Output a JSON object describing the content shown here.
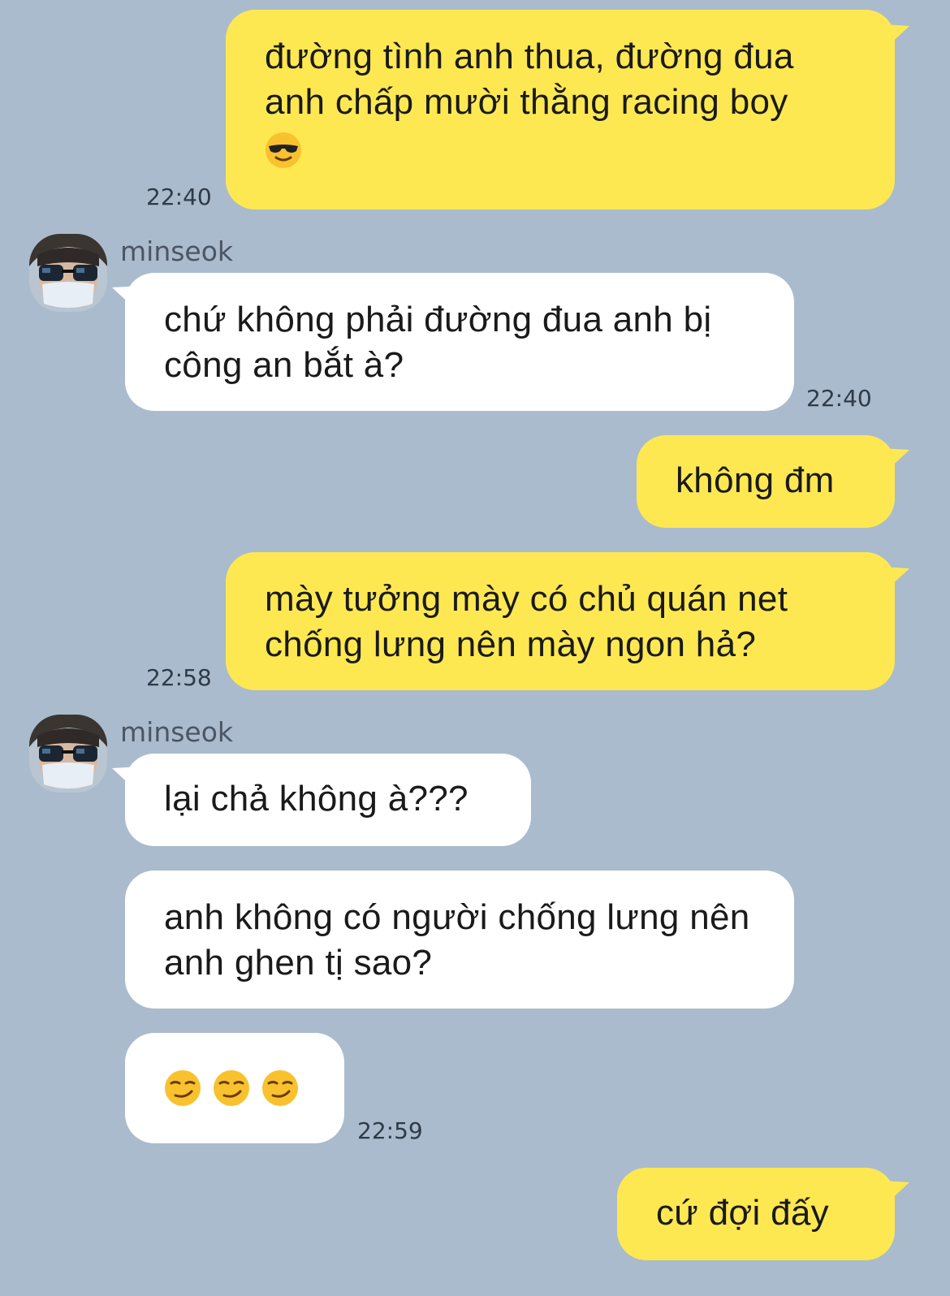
{
  "contact": {
    "name": "minseok"
  },
  "messages": [
    {
      "id": "m1",
      "from": "me",
      "text": "đường tình anh thua, đường đua anh chấp mười thằng racing boy",
      "emoji": "smiling-face-with-sunglasses",
      "time": "22:40"
    },
    {
      "id": "m2",
      "from": "minseok",
      "text": "chứ không phải đường đua anh bị công an bắt à?",
      "time": "22:40"
    },
    {
      "id": "m3",
      "from": "me",
      "text": "không đm"
    },
    {
      "id": "m4",
      "from": "me",
      "text": "mày tưởng mày có chủ quán net chống lưng nên mày ngon hả?",
      "time": "22:58"
    },
    {
      "id": "m5",
      "from": "minseok",
      "text": "lại chả không à???"
    },
    {
      "id": "m6",
      "from": "minseok",
      "text": "anh không có người chống lưng nên anh ghen tị sao?"
    },
    {
      "id": "m7",
      "from": "minseok",
      "emojis": [
        "smirking-face",
        "smirking-face",
        "smirking-face"
      ],
      "time": "22:59"
    },
    {
      "id": "m8",
      "from": "me",
      "text": "cứ đợi đấy"
    }
  ],
  "colors": {
    "background": "#aabbcd",
    "my_bubble": "#fee852",
    "their_bubble": "#ffffff"
  },
  "icons": {
    "avatar": "avatar-sunglasses-mask"
  }
}
